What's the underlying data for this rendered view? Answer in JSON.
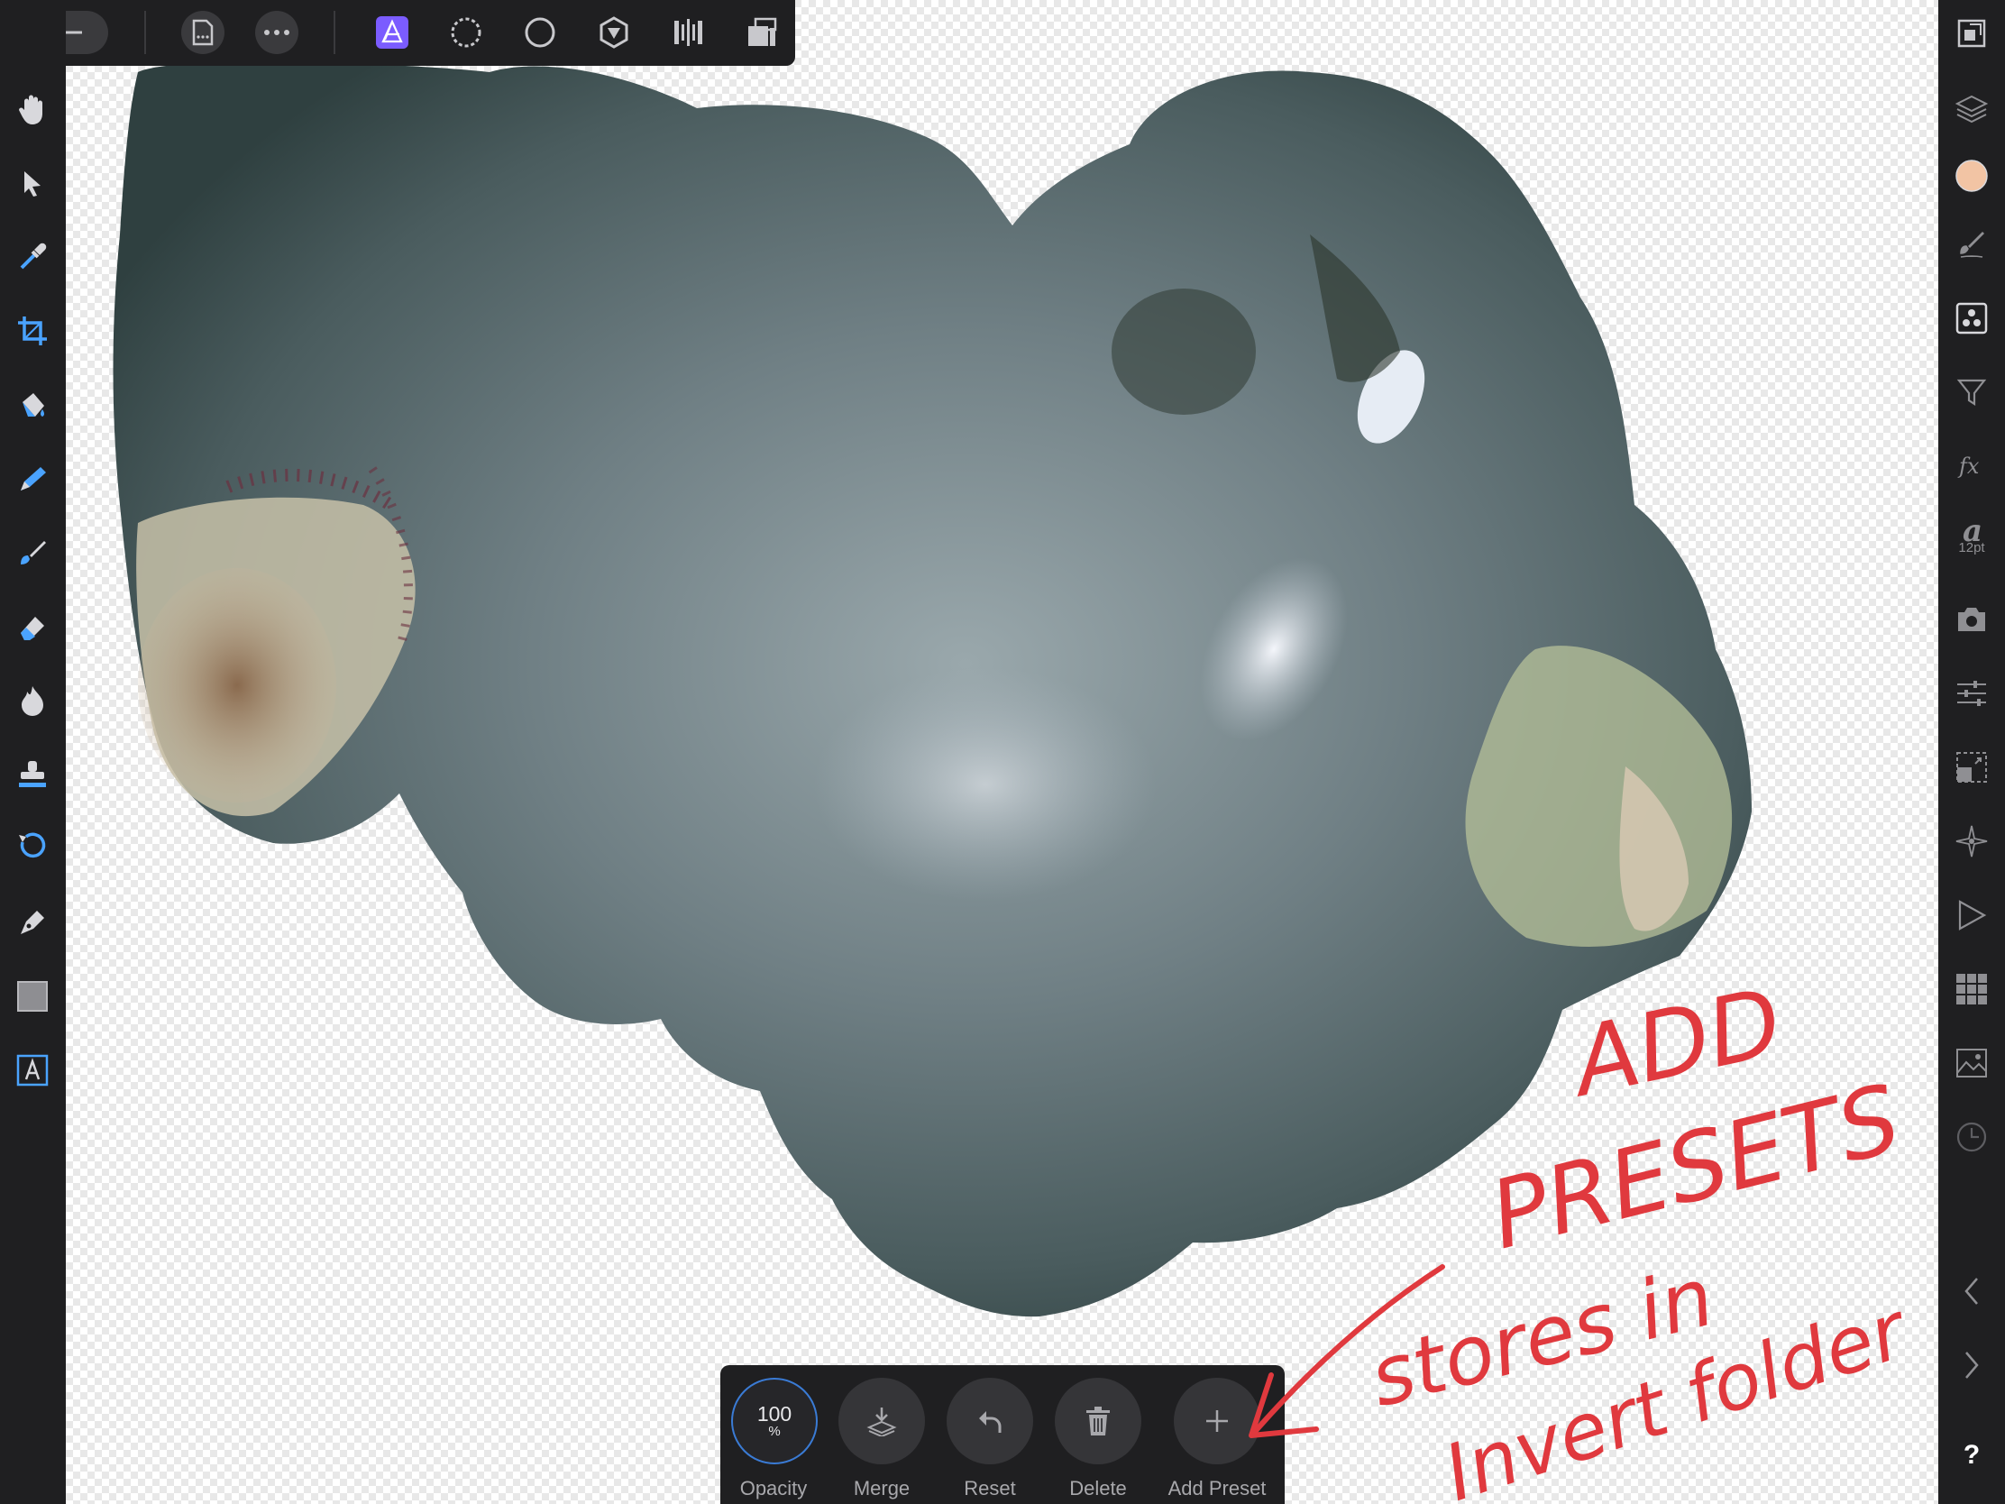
{
  "colors": {
    "accent": "#7b5cff",
    "annotation": "#e0393e",
    "swatch": "#f2c4a4",
    "ui_bg": "#1f1f21"
  },
  "top_toolbar": {
    "buttons": [
      "back-arrow-icon",
      "document-icon",
      "more-icon",
      "photo-persona-icon",
      "liquify-persona-icon",
      "develop-persona-icon",
      "tone-mapping-persona-icon",
      "export-persona-icon",
      "view-modes-icon"
    ]
  },
  "left_toolbar": {
    "tools": [
      "hand-tool",
      "move-tool",
      "color-picker-tool",
      "crop-tool",
      "flood-fill-tool",
      "selection-brush-tool",
      "paint-brush-tool",
      "erase-brush-tool",
      "burn-tool",
      "clone-tool",
      "healing-tool",
      "pen-tool",
      "rectangle-tool",
      "text-tool"
    ]
  },
  "right_toolbar": {
    "studios": [
      "canvas-size-icon",
      "layers-icon",
      "color-icon",
      "brushes-icon",
      "channels-icon",
      "adjustments-icon",
      "effects-icon",
      "text-styles-icon",
      "camera-icon",
      "sliders-icon",
      "transform-icon",
      "navigator-icon",
      "macro-icon",
      "swatches-icon",
      "image-icon",
      "history-icon"
    ],
    "text_size": "12pt",
    "help_label": "?"
  },
  "context_toolbar": {
    "opacity": {
      "value": "100",
      "unit": "%",
      "label": "Opacity"
    },
    "merge_label": "Merge",
    "reset_label": "Reset",
    "delete_label": "Delete",
    "add_preset_label": "Add Preset"
  },
  "annotation": {
    "line1": "ADD",
    "line2": "PRESETS",
    "line3": "stores in",
    "line4": "Invert folder"
  }
}
